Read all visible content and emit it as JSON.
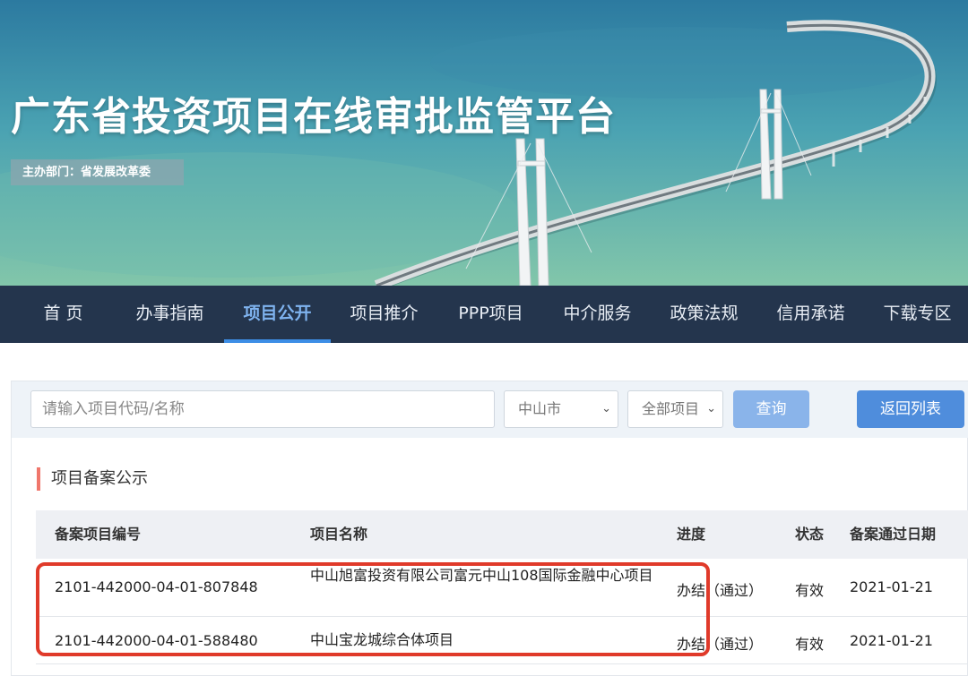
{
  "banner": {
    "title": "广东省投资项目在线审批监管平台",
    "host": "主办部门：省发展改革委"
  },
  "nav": {
    "items": [
      "首 页",
      "办事指南",
      "项目公开",
      "项目推介",
      "PPP项目",
      "中介服务",
      "政策法规",
      "信用承诺",
      "下载专区"
    ],
    "active": "项目公开"
  },
  "search": {
    "placeholder": "请输入项目代码/名称",
    "value": "",
    "city": "中山市",
    "type": "全部项目",
    "query_label": "查询",
    "back_label": "返回列表"
  },
  "section": {
    "title": "项目备案公示"
  },
  "table": {
    "headers": [
      "备案项目编号",
      "项目名称",
      "进度",
      "状态",
      "备案通过日期"
    ],
    "rows": [
      {
        "code": "2101-442000-04-01-807848",
        "name": "中山旭富投资有限公司富元中山108国际金融中心项目",
        "progress": "办结（通过）",
        "status": "有效",
        "date": "2021-01-21"
      },
      {
        "code": "2101-442000-04-01-588480",
        "name": "中山宝龙城综合体项目",
        "progress": "办结（通过）",
        "status": "有效",
        "date": "2021-01-21"
      }
    ]
  },
  "colors": {
    "nav_bg": "#1b2d46",
    "nav_active": "#7fb3ef",
    "query_button": "#8ab4ea",
    "back_button": "#4f8ddc",
    "section_accent": "#f0766b",
    "highlight": "#e03a2a"
  },
  "icons": {
    "select_arrow": "chevron-down-icon"
  }
}
